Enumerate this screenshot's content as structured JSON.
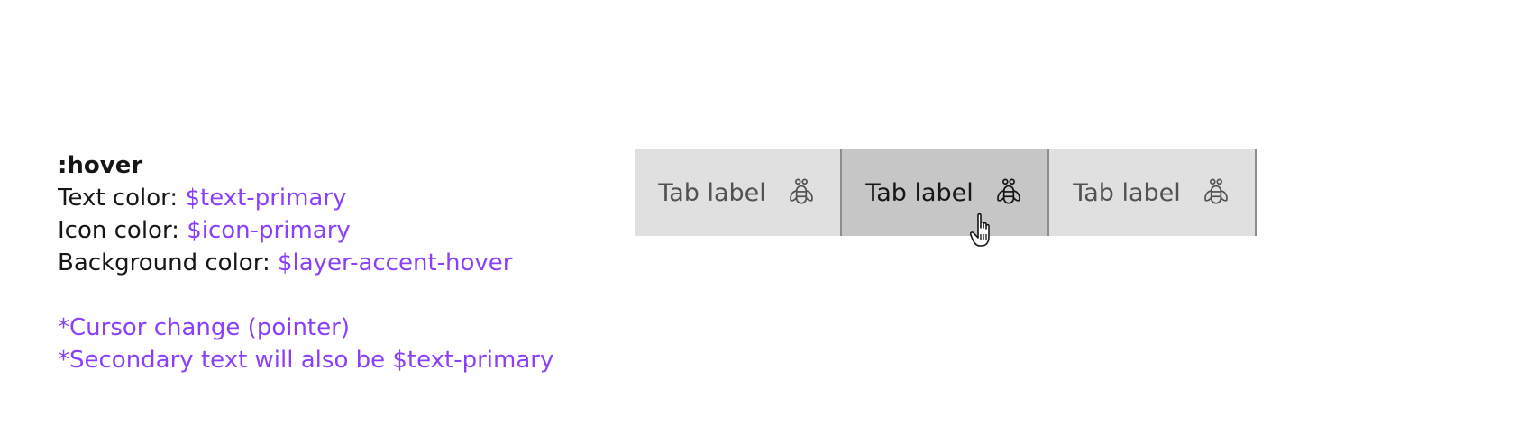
{
  "spec": {
    "state": ":hover",
    "text_color_label": "Text color: ",
    "text_color_token": "$text-primary",
    "icon_color_label": "Icon color: ",
    "icon_color_token": "$icon-primary",
    "bg_color_label": "Background color: ",
    "bg_color_token": "$layer-accent-hover",
    "note_cursor": "*Cursor change (pointer)",
    "note_secondary": "*Secondary text will also be $text-primary"
  },
  "tabs": [
    {
      "label": "Tab label",
      "icon": "bee-icon",
      "state": "default"
    },
    {
      "label": "Tab label",
      "icon": "bee-icon",
      "state": "hover"
    },
    {
      "label": "Tab label",
      "icon": "bee-icon",
      "state": "default"
    }
  ],
  "cursor": {
    "icon": "pointer-hand-cursor"
  },
  "colors": {
    "token_accent": "#8a3ffc",
    "tab_background": "#e0e0e0",
    "tab_hover_background": "#c6c6c6",
    "text_primary": "#161616",
    "text_secondary": "#525252",
    "tab_divider": "#8d8d8d"
  }
}
